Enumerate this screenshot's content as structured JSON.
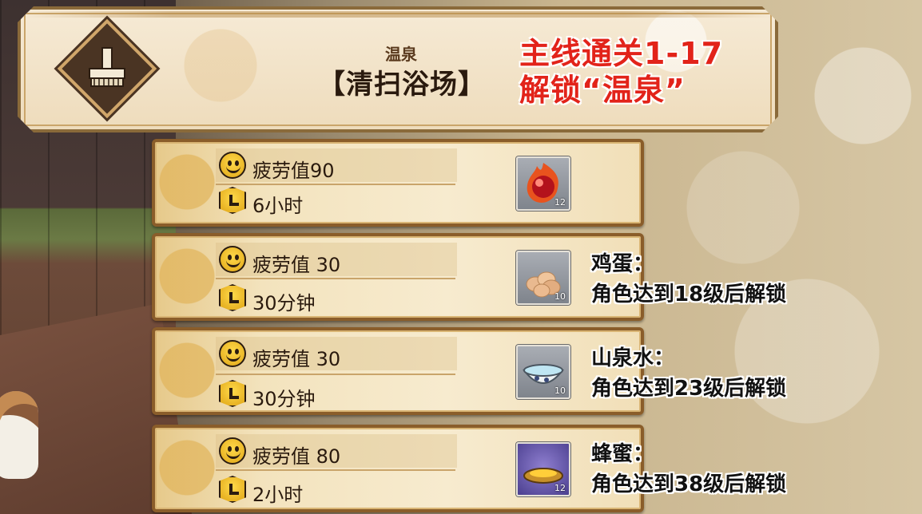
{
  "header": {
    "subtitle": "温泉",
    "title": "【清扫浴场】",
    "note_line1": "主线通关1-17",
    "note_line2": "解锁“温泉”",
    "icon": "broom-icon"
  },
  "tasks": [
    {
      "fatigue_label": "疲劳值90",
      "duration_label": "6小时",
      "reward": {
        "icon": "fire-orb-icon",
        "count": "12",
        "style": "gray"
      },
      "unlock_title": "",
      "unlock_desc": ""
    },
    {
      "fatigue_label": "疲劳值 30",
      "duration_label": "30分钟",
      "reward": {
        "icon": "eggs-icon",
        "count": "10",
        "style": "gray"
      },
      "unlock_title": "鸡蛋：",
      "unlock_desc": "角色达到18级后解锁"
    },
    {
      "fatigue_label": "疲劳值 30",
      "duration_label": "30分钟",
      "reward": {
        "icon": "water-bowl-icon",
        "count": "10",
        "style": "gray"
      },
      "unlock_title": "山泉水：",
      "unlock_desc": "角色达到23级后解锁"
    },
    {
      "fatigue_label": "疲劳值 80",
      "duration_label": "2小时",
      "reward": {
        "icon": "honey-plate-icon",
        "count": "12",
        "style": "purple"
      },
      "unlock_title": "蜂蜜：",
      "unlock_desc": "角色达到38级后解锁"
    }
  ],
  "colors": {
    "note_red": "#e2231a",
    "frame_brown": "#8a5d2a",
    "badge_yellow": "#ffd94a"
  }
}
